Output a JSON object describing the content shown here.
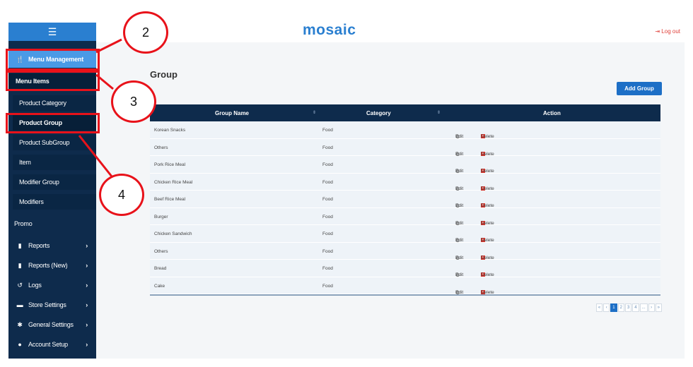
{
  "app": {
    "logo": "mosaic",
    "logout_label": "Log out"
  },
  "sidebar": {
    "menu_management": "Menu Management",
    "menu_items": "Menu Items",
    "sub_items": [
      "Product Category",
      "Product Group",
      "Product SubGroup",
      "Item",
      "Modifier Group",
      "Modifiers"
    ],
    "promo": "Promo",
    "items": [
      {
        "label": "Reports",
        "icon": "file-icon"
      },
      {
        "label": "Reports (New)",
        "icon": "file-icon"
      },
      {
        "label": "Logs",
        "icon": "history-icon"
      },
      {
        "label": "Store Settings",
        "icon": "storage-icon"
      },
      {
        "label": "General Settings",
        "icon": "gear-icon"
      },
      {
        "label": "Account Setup",
        "icon": "user-icon"
      }
    ]
  },
  "page": {
    "title": "Group",
    "add_button": "Add Group"
  },
  "table": {
    "columns": [
      "Group Name",
      "Category",
      "Action"
    ],
    "edit_label": "Edit",
    "delete_label": "Delete",
    "rows": [
      [
        "Korean Snacks",
        "Food"
      ],
      [
        "Others",
        "Food"
      ],
      [
        "Pork Rice Meal",
        "Food"
      ],
      [
        "Chicken Rice Meal",
        "Food"
      ],
      [
        "Beef Rice Meal",
        "Food"
      ],
      [
        "Burger",
        "Food"
      ],
      [
        "Chicken Sandwich",
        "Food"
      ],
      [
        "Others",
        "Food"
      ],
      [
        "Bread",
        "Food"
      ],
      [
        "Cake",
        "Food"
      ]
    ]
  },
  "pagination": [
    "«",
    "‹",
    "1",
    "2",
    "3",
    "4",
    "...",
    "›",
    "»"
  ],
  "pagination_active": "1",
  "annotations": [
    "2",
    "3",
    "4"
  ],
  "colors": {
    "annotation": "#e8121a",
    "sidebar": "#0e2b4c",
    "accent": "#2a7fd0"
  }
}
